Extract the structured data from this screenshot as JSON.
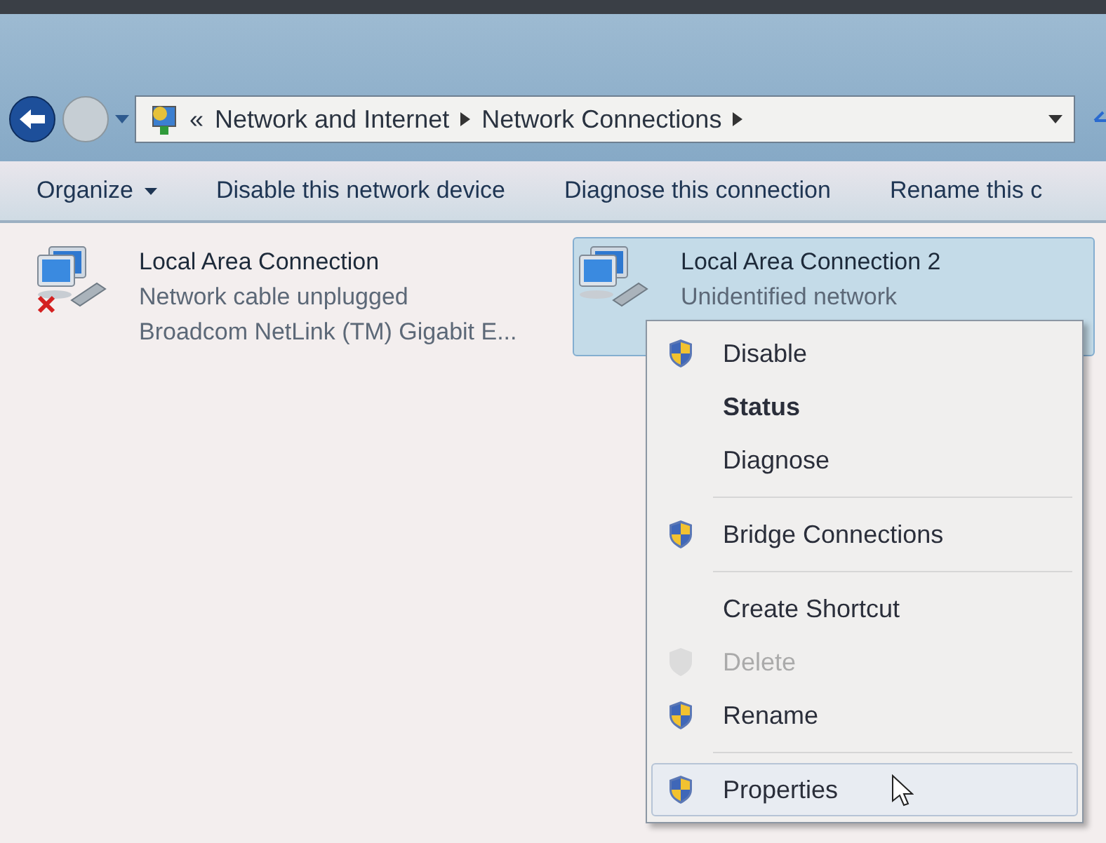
{
  "address_bar": {
    "overflow": "«",
    "crumbs": [
      "Network and Internet",
      "Network Connections"
    ]
  },
  "toolbar": {
    "items": [
      {
        "label": "Organize",
        "dropdown": true
      },
      {
        "label": "Disable this network device",
        "dropdown": false
      },
      {
        "label": "Diagnose this connection",
        "dropdown": false
      },
      {
        "label": "Rename this c",
        "dropdown": false
      }
    ]
  },
  "connections": [
    {
      "name": "Local Area Connection",
      "status": "Network cable unplugged",
      "device": "Broadcom NetLink (TM) Gigabit E...",
      "selected": false,
      "error": true
    },
    {
      "name": "Local Area Connection 2",
      "status": "Unidentified network",
      "selected": true,
      "error": false
    }
  ],
  "context_menu": {
    "items": [
      {
        "kind": "item",
        "label": "Disable",
        "shield": true,
        "bold": false,
        "disabled": false,
        "selected": false
      },
      {
        "kind": "item",
        "label": "Status",
        "shield": false,
        "bold": true,
        "disabled": false,
        "selected": false
      },
      {
        "kind": "item",
        "label": "Diagnose",
        "shield": false,
        "bold": false,
        "disabled": false,
        "selected": false
      },
      {
        "kind": "separator"
      },
      {
        "kind": "item",
        "label": "Bridge Connections",
        "shield": true,
        "bold": false,
        "disabled": false,
        "selected": false
      },
      {
        "kind": "separator"
      },
      {
        "kind": "item",
        "label": "Create Shortcut",
        "shield": false,
        "bold": false,
        "disabled": false,
        "selected": false
      },
      {
        "kind": "item",
        "label": "Delete",
        "shield": true,
        "bold": false,
        "disabled": true,
        "selected": false
      },
      {
        "kind": "item",
        "label": "Rename",
        "shield": true,
        "bold": false,
        "disabled": false,
        "selected": false
      },
      {
        "kind": "separator"
      },
      {
        "kind": "item",
        "label": "Properties",
        "shield": true,
        "bold": false,
        "disabled": false,
        "selected": true
      }
    ]
  }
}
